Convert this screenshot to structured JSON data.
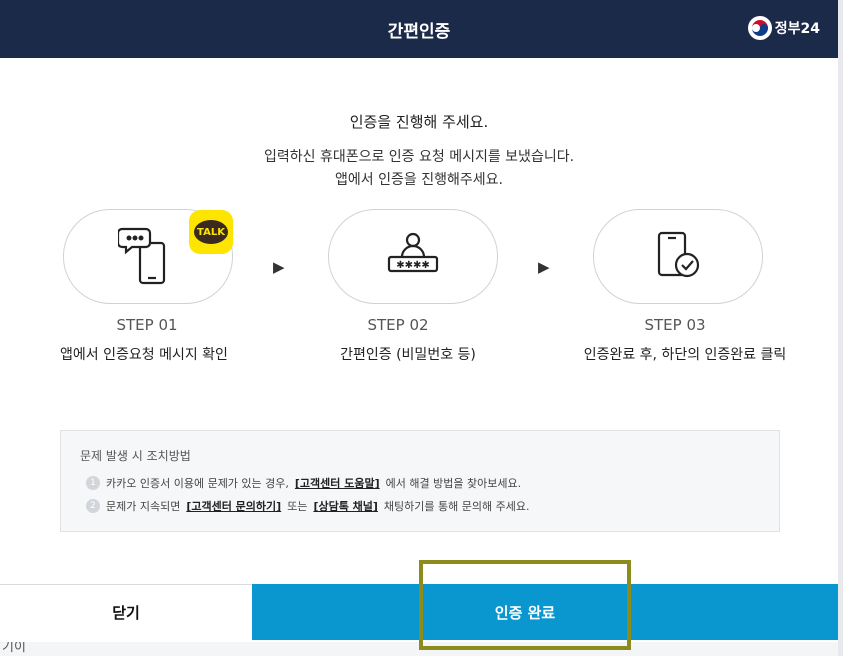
{
  "header": {
    "title": "간편인증",
    "logo_text": "정부24"
  },
  "message": {
    "title": "인증을 진행해 주세요.",
    "line1": "입력하신 휴대폰으로 인증 요청 메시지를 보냈습니다.",
    "line2": "앱에서 인증을 진행해주세요."
  },
  "talk_badge": "TALK",
  "steps": [
    {
      "number": "STEP 01",
      "desc": "앱에서 인증요청 메시지 확인",
      "icon": "chat-phone-icon"
    },
    {
      "number": "STEP 02",
      "desc": "간편인증 (비밀번호 등)",
      "icon": "user-password-icon"
    },
    {
      "number": "STEP 03",
      "desc": "인증완료 후, 하단의 인증완료 클릭",
      "icon": "phone-check-icon"
    }
  ],
  "help": {
    "title": "문제 발생 시 조치방법",
    "item1": {
      "num": "1",
      "pre": "카카오 인증서 이용에 문제가 있는 경우,",
      "link": "[고객센터 도움말]",
      "post": "에서 해결 방법을 찾아보세요."
    },
    "item2": {
      "num": "2",
      "pre": "문제가 지속되면",
      "link1": "[고객센터 문의하기]",
      "mid": "또는",
      "link2": "[상담톡 채널]",
      "post": "채팅하기를 통해 문의해 주세요."
    }
  },
  "buttons": {
    "close": "닫기",
    "confirm": "인증 완료"
  },
  "background_text": "기이",
  "colors": {
    "header": "#1c2a49",
    "primary": "#0a97cf",
    "highlight_border": "#8b8b1e",
    "kakao_yellow": "#fee500"
  }
}
